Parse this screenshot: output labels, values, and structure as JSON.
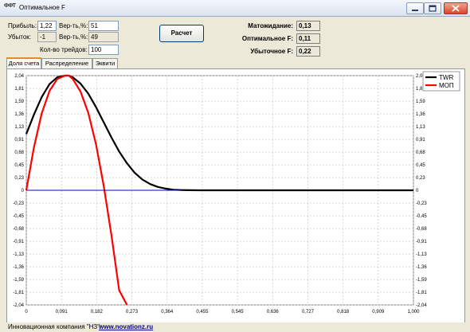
{
  "window": {
    "icon_text": "ФФТ",
    "title": "Оптимальное F"
  },
  "inputs": {
    "profit_label": "Прибыль:",
    "profit_value": "1,22",
    "loss_label": "Убыток:",
    "loss_value": "-1",
    "prob_win_label": "Вер-ть,%:",
    "prob_win_value": "51",
    "prob_loss_label": "Вер-ть,%:",
    "prob_loss_value": "49",
    "trades_label": "Кол-во трейдов:",
    "trades_value": "100"
  },
  "calc_button": "Расчет",
  "results": {
    "expectation_label": "Матожидание:",
    "expectation_value": "0,13",
    "optimal_f_label": "Оптимальное F:",
    "optimal_f_value": "0,11",
    "losing_f_label": "Убыточное F:",
    "losing_f_value": "0,22"
  },
  "tabs": [
    {
      "label": "Доля счета",
      "active": true
    },
    {
      "label": "Распределение",
      "active": false
    },
    {
      "label": "Эквити",
      "active": false
    }
  ],
  "chart_data": {
    "type": "line",
    "xlim": [
      0,
      1
    ],
    "ylim": [
      -2.04,
      2.04
    ],
    "x_ticks": [
      "0",
      "0,091",
      "0,182",
      "0,273",
      "0,364",
      "0,455",
      "0,545",
      "0,636",
      "0,727",
      "0,818",
      "0,909",
      "1,000"
    ],
    "y_ticks": [
      "2,04",
      "1,81",
      "1,59",
      "1,36",
      "1,13",
      "0,91",
      "0,68",
      "0,45",
      "0,23",
      "0",
      "-0,23",
      "-0,45",
      "-0,68",
      "-0,91",
      "-1,13",
      "-1,36",
      "-1,59",
      "-1,81",
      "-2,04"
    ],
    "y_ticks_right": [
      "2,04",
      "1,81",
      "1,59",
      "1,36",
      "1,13",
      "0,91",
      "0,68",
      "0,45",
      "0,23",
      "0",
      "-0,23",
      "-0,45",
      "-0,68",
      "-0,91",
      "-1,13",
      "-1,36",
      "-1,59",
      "-1,81",
      "-2,04"
    ],
    "grid": true,
    "legend_position": "top-right",
    "series": [
      {
        "name": "TWR",
        "color": "#000000",
        "x": [
          0,
          0.02,
          0.04,
          0.06,
          0.08,
          0.1,
          0.11,
          0.12,
          0.14,
          0.16,
          0.18,
          0.2,
          0.22,
          0.24,
          0.26,
          0.28,
          0.3,
          0.32,
          0.34,
          0.36,
          0.38,
          0.4,
          0.42,
          0.45,
          0.5,
          0.6,
          0.7,
          0.8,
          0.9,
          1.0
        ],
        "y": [
          1.0,
          1.35,
          1.66,
          1.89,
          2.01,
          2.04,
          2.04,
          2.01,
          1.9,
          1.72,
          1.48,
          1.21,
          0.94,
          0.69,
          0.48,
          0.31,
          0.19,
          0.11,
          0.06,
          0.03,
          0.01,
          0.004,
          0.001,
          0,
          0,
          0,
          0,
          0,
          0,
          0
        ]
      },
      {
        "name": "МОП",
        "color": "#ff0000",
        "x": [
          0,
          0.02,
          0.04,
          0.06,
          0.08,
          0.1,
          0.11,
          0.12,
          0.14,
          0.16,
          0.18,
          0.2,
          0.22,
          0.24,
          0.26
        ],
        "y": [
          0,
          0.77,
          1.37,
          1.77,
          1.98,
          2.04,
          2.04,
          1.98,
          1.76,
          1.38,
          0.82,
          0.08,
          -0.8,
          -1.78,
          -2.04
        ]
      },
      {
        "name": "",
        "color": "#0000cc",
        "x": [
          0,
          0.4
        ],
        "y": [
          0,
          0
        ]
      }
    ]
  },
  "status": {
    "company": "Инновационная компания \"НЗ\":",
    "link": "www.novationz.ru"
  }
}
